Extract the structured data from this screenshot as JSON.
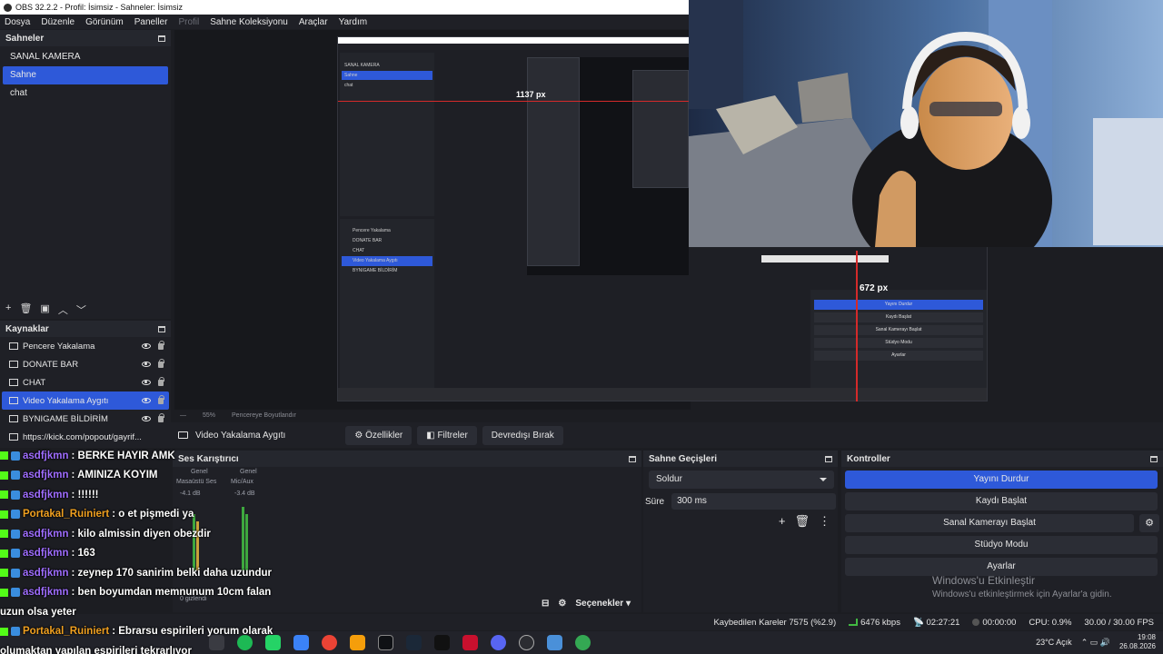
{
  "window": {
    "title": "OBS 32.2.2 - Profil: İsimsiz - Sahneler: İsimsiz"
  },
  "menu": [
    "Dosya",
    "Düzenle",
    "Görünüm",
    "Paneller",
    "Profil",
    "Sahne Koleksiyonu",
    "Araçlar",
    "Yardım"
  ],
  "scenes": {
    "title": "Sahneler",
    "items": [
      "SANAL KAMERA",
      "Sahne",
      "chat"
    ]
  },
  "sources": {
    "title": "Kaynaklar",
    "items": [
      "Pencere Yakalama",
      "DONATE BAR",
      "CHAT",
      "Video Yakalama Aygıtı",
      "BYNIGAME BİLDİRİM",
      "https://kick.com/popout/gayrif..."
    ]
  },
  "preview": {
    "measure_h": "1137 px",
    "measure_v": "672 px",
    "zoom": "55%",
    "fit_label": "Pencereye Boyutlandır"
  },
  "source_bar": {
    "name": "Video Yakalama Aygıtı",
    "properties": "Özellikler",
    "filters": "Filtreler",
    "deactivate": "Devredışı Bırak"
  },
  "mixer": {
    "title": "Ses Karıştırıcı",
    "ch1_head": "Genel",
    "ch1_name": "Masaüstü Ses",
    "ch1_db": "-4.1 dB",
    "ch2_head": "Genel",
    "ch2_name": "Mic/Aux",
    "ch2_db": "-3.4 dB",
    "hidden": "0 gizlendi",
    "options": "Seçenekler"
  },
  "transitions": {
    "title": "Sahne Geçişleri",
    "selected": "Soldur",
    "duration_label": "Süre",
    "duration_value": "300 ms"
  },
  "controls": {
    "title": "Kontroller",
    "stop_stream": "Yayını Durdur",
    "start_record": "Kaydı Başlat",
    "start_virtualcam": "Sanal Kamerayı Başlat",
    "studio_mode": "Stüdyo Modu",
    "settings": "Ayarlar",
    "activate_title": "Windows'u Etkinleştir",
    "activate_sub": "Windows'u etkinleştirmek için Ayarlar'a gidin."
  },
  "status": {
    "dropped": "Kaybedilen Kareler 7575 (%2.9)",
    "bitrate": "6476 kbps",
    "stream_time": "02:27:21",
    "rec_time": "00:00:00",
    "cpu": "CPU: 0.9%",
    "fps": "30.00 / 30.00 FPS"
  },
  "tray": {
    "weather": "23°C Açık",
    "time": "19:08",
    "date": "26.08.2026"
  },
  "chat": [
    {
      "user": "asdfjkmn",
      "msg": ": BERKE HAYIR AMK",
      "gold": false
    },
    {
      "user": "asdfjkmn",
      "msg": ": AMINIZA KOYIM",
      "gold": false
    },
    {
      "user": "asdfjkmn",
      "msg": ": !!!!!!",
      "gold": false
    },
    {
      "user": "Portakal_Ruiniert",
      "msg": ": o et pişmedi ya",
      "gold": true
    },
    {
      "user": "asdfjkmn",
      "msg": ": kilo almissin diyen obezdir",
      "gold": false
    },
    {
      "user": "asdfjkmn",
      "msg": ": 163",
      "gold": false
    },
    {
      "user": "asdfjkmn",
      "msg": ": zeynep 170 sanirim belki daha uzundur",
      "gold": false
    },
    {
      "user": "asdfjkmn",
      "msg": ": ben boyumdan memnunum 10cm falan",
      "gold": false
    },
    {
      "user": "",
      "msg": "uzun olsa yeter",
      "gold": false
    },
    {
      "user": "Portakal_Ruiniert",
      "msg": ": Ebrarsu espirileri yorum olarak",
      "gold": true
    },
    {
      "user": "",
      "msg": "olumaktan yapılan espirileri tekrarlıyor",
      "gold": false
    }
  ],
  "nested": {
    "scene_items": [
      "SANAL KAMERA",
      "Sahne",
      "chat"
    ],
    "source_items": [
      "Pencere Yakalama",
      "DONATE BAR",
      "CHAT",
      "Video Yakalama Aygıtı",
      "BYNIGAME BİLDİRİM"
    ],
    "controls": [
      "Yayını Durdur",
      "Kaydı Başlat",
      "Sanal Kamerayı Başlat",
      "Stüdyo Modu",
      "Ayarlar"
    ]
  },
  "colors": {
    "accent": "#2e59d9",
    "panel": "#1f2026",
    "bg": "#1c1d22",
    "kick": "#53fc18"
  }
}
